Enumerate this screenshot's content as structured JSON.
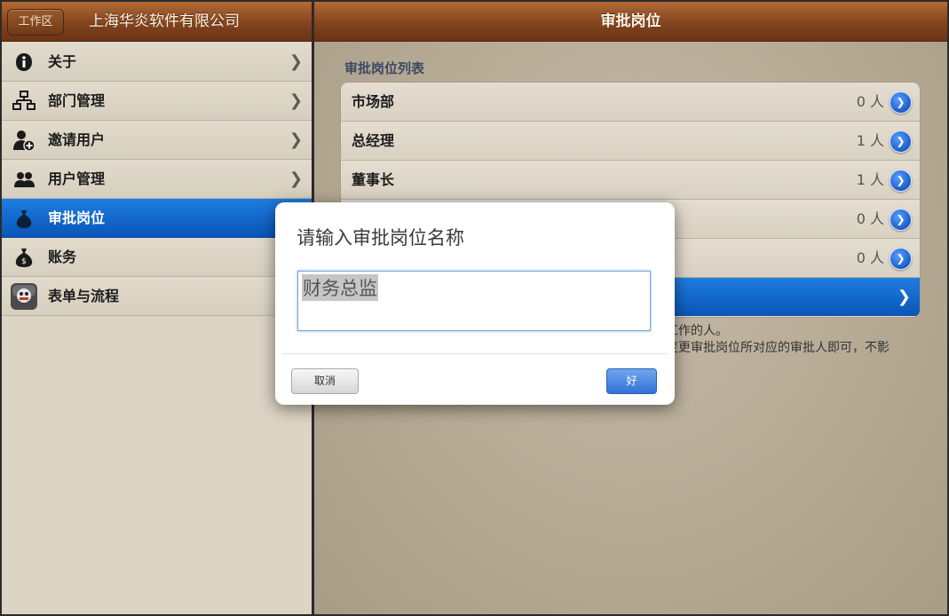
{
  "left_header": {
    "back_label": "工作区",
    "title": "上海华炎软件有限公司"
  },
  "menu": [
    {
      "label": "关于",
      "icon": "info-icon",
      "selected": false,
      "chevron": true
    },
    {
      "label": "部门管理",
      "icon": "org-chart-icon",
      "selected": false,
      "chevron": true
    },
    {
      "label": "邀请用户",
      "icon": "add-user-icon",
      "selected": false,
      "chevron": true
    },
    {
      "label": "用户管理",
      "icon": "users-icon",
      "selected": false,
      "chevron": true
    },
    {
      "label": "审批岗位",
      "icon": "money-bag-icon",
      "selected": true,
      "chevron": false
    },
    {
      "label": "账务",
      "icon": "money-bag-icon",
      "selected": false,
      "chevron": false
    },
    {
      "label": "表单与流程",
      "icon": "form-app-icon",
      "selected": false,
      "chevron": false
    }
  ],
  "right_header": {
    "title": "审批岗位"
  },
  "section": {
    "title": "审批岗位列表"
  },
  "positions": [
    {
      "name": "市场部",
      "count": "0 人"
    },
    {
      "name": "总经理",
      "count": "1 人"
    },
    {
      "name": "董事长",
      "count": "1 人"
    },
    {
      "name": "",
      "count": "0 人"
    },
    {
      "name": "",
      "count": "0 人"
    }
  ],
  "footnote": [
    "同工作的人。",
    "需变更审批岗位所对应的审批人即可，不影",
    "。"
  ],
  "dialog": {
    "title": "请输入审批岗位名称",
    "input_value": "财务总监",
    "cancel_label": "取消",
    "ok_label": "好"
  },
  "colors": {
    "selection_blue": "#0a55b8",
    "wood": "#8a4a22",
    "ok_blue": "#3372d6"
  }
}
